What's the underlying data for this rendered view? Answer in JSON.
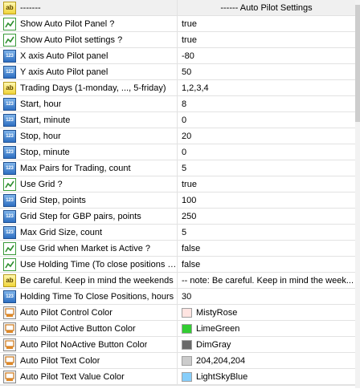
{
  "header": {
    "name": "-------",
    "value": "------ Auto Pilot Settings"
  },
  "rows": [
    {
      "icon": "bool",
      "name": "Show Auto Pilot Panel ?",
      "value": "true"
    },
    {
      "icon": "bool",
      "name": "Show Auto Pilot settings ?",
      "value": "true"
    },
    {
      "icon": "number",
      "name": "X axis Auto Pilot panel",
      "value": "-80"
    },
    {
      "icon": "number",
      "name": "Y axis Auto Pilot panel",
      "value": "50"
    },
    {
      "icon": "string",
      "name": "Trading Days (1-monday, ..., 5-friday)",
      "value": "1,2,3,4"
    },
    {
      "icon": "number",
      "name": "Start, hour",
      "value": "8"
    },
    {
      "icon": "number",
      "name": "Start, minute",
      "value": "0"
    },
    {
      "icon": "number",
      "name": "Stop, hour",
      "value": "20"
    },
    {
      "icon": "number",
      "name": "Stop, minute",
      "value": "0"
    },
    {
      "icon": "number",
      "name": "Max Pairs for Trading, count",
      "value": "5"
    },
    {
      "icon": "bool",
      "name": "Use Grid ?",
      "value": "true"
    },
    {
      "icon": "number",
      "name": "Grid Step, points",
      "value": "100"
    },
    {
      "icon": "number",
      "name": "Grid Step for GBP pairs, points",
      "value": "250"
    },
    {
      "icon": "number",
      "name": "Max Grid Size, count",
      "value": "5"
    },
    {
      "icon": "bool",
      "name": "Use Grid when Market is Active ?",
      "value": "false"
    },
    {
      "icon": "bool",
      "name": "Use Holding Time (To close positions a...",
      "value": "false"
    },
    {
      "icon": "string",
      "name": "Be careful.  Keep in mind the weekends",
      "value": "-- note: Be careful.  Keep in mind the week..."
    },
    {
      "icon": "number",
      "name": "Holding Time To Close Positions, hours",
      "value": "30"
    },
    {
      "icon": "color",
      "name": "Auto Pilot Control Color",
      "value": "MistyRose",
      "color": "#ffe4e1"
    },
    {
      "icon": "color",
      "name": "Auto Pilot Active Button Color",
      "value": "LimeGreen",
      "color": "#32cd32"
    },
    {
      "icon": "color",
      "name": "Auto Pilot NoActive Button Color",
      "value": "DimGray",
      "color": "#696969"
    },
    {
      "icon": "color",
      "name": "Auto Pilot Text Color",
      "value": "204,204,204",
      "color": "#cccccc"
    },
    {
      "icon": "color",
      "name": "Auto Pilot Text Value Color",
      "value": "LightSkyBlue",
      "color": "#87cefa"
    }
  ],
  "icons": {
    "string": "ab",
    "number": "123",
    "bool": "bool-check-icon",
    "color": "palette-icon"
  }
}
